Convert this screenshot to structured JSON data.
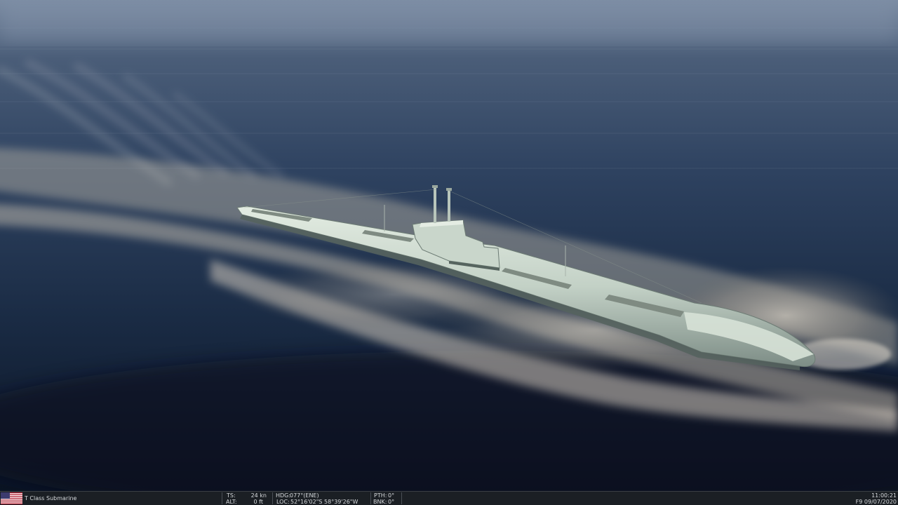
{
  "unit": {
    "name": "T Class Submarine",
    "country_flag_icon": "usa-flag-icon"
  },
  "telemetry": {
    "ts_label": "TS:",
    "ts_value": "24 kn",
    "alt_label": "ALT:",
    "alt_value": "0 ft",
    "hdg_label": "HDG:",
    "hdg_value": "077°(ENE)",
    "loc_label": "LOC:",
    "loc_value": "52°16'02\"S 58°39'26\"W",
    "pth_label": "PTH:",
    "pth_value": "0°",
    "bnk_label": "BNK:",
    "bnk_value": "0°"
  },
  "clock": {
    "time": "11:00:21",
    "date": "F9 09/07/2020"
  },
  "colors": {
    "sea_dark": "#0b1626",
    "sea_mid": "#2a3a52",
    "sea_light": "#6d7f97",
    "foam": "#c9c3b6",
    "hull": "#c6d4c9",
    "status_bg": "#1b1f24"
  }
}
